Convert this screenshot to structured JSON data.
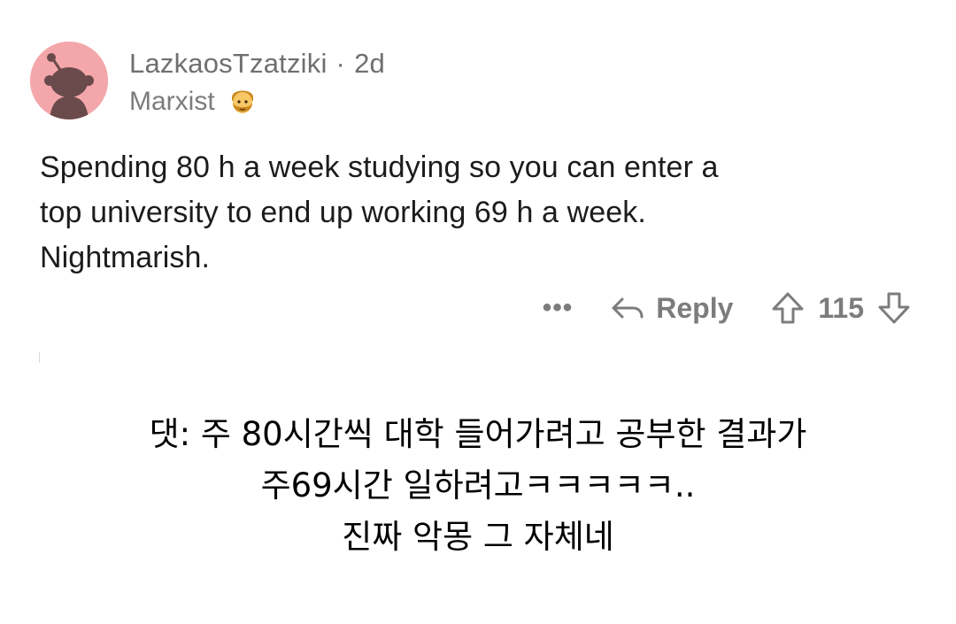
{
  "comment": {
    "username": "LazkaosTzatziki",
    "separator": "·",
    "age": "2d",
    "flair": "Marxist",
    "flair_emoji_icon": "man-bearded-emoji-icon",
    "body": "Spending 80 h a week studying so you can enter a\ntop university to end up working 69 h a week.\nNightmarish.",
    "actions": {
      "more_label": "•••",
      "reply_label": "Reply",
      "score": "115"
    }
  },
  "caption": {
    "line1": "댓: 주 80시간씩 대학 들어가려고 공부한 결과가",
    "line2": "주69시간 일하려고ㅋㅋㅋㅋㅋ..",
    "line3": "진짜 악몽 그 자체네"
  },
  "colors": {
    "avatar_bg": "#f4a7aa",
    "meta_text": "#6f6f6f",
    "body_text": "#1c1c1c",
    "action_text": "#7c7c7c"
  }
}
